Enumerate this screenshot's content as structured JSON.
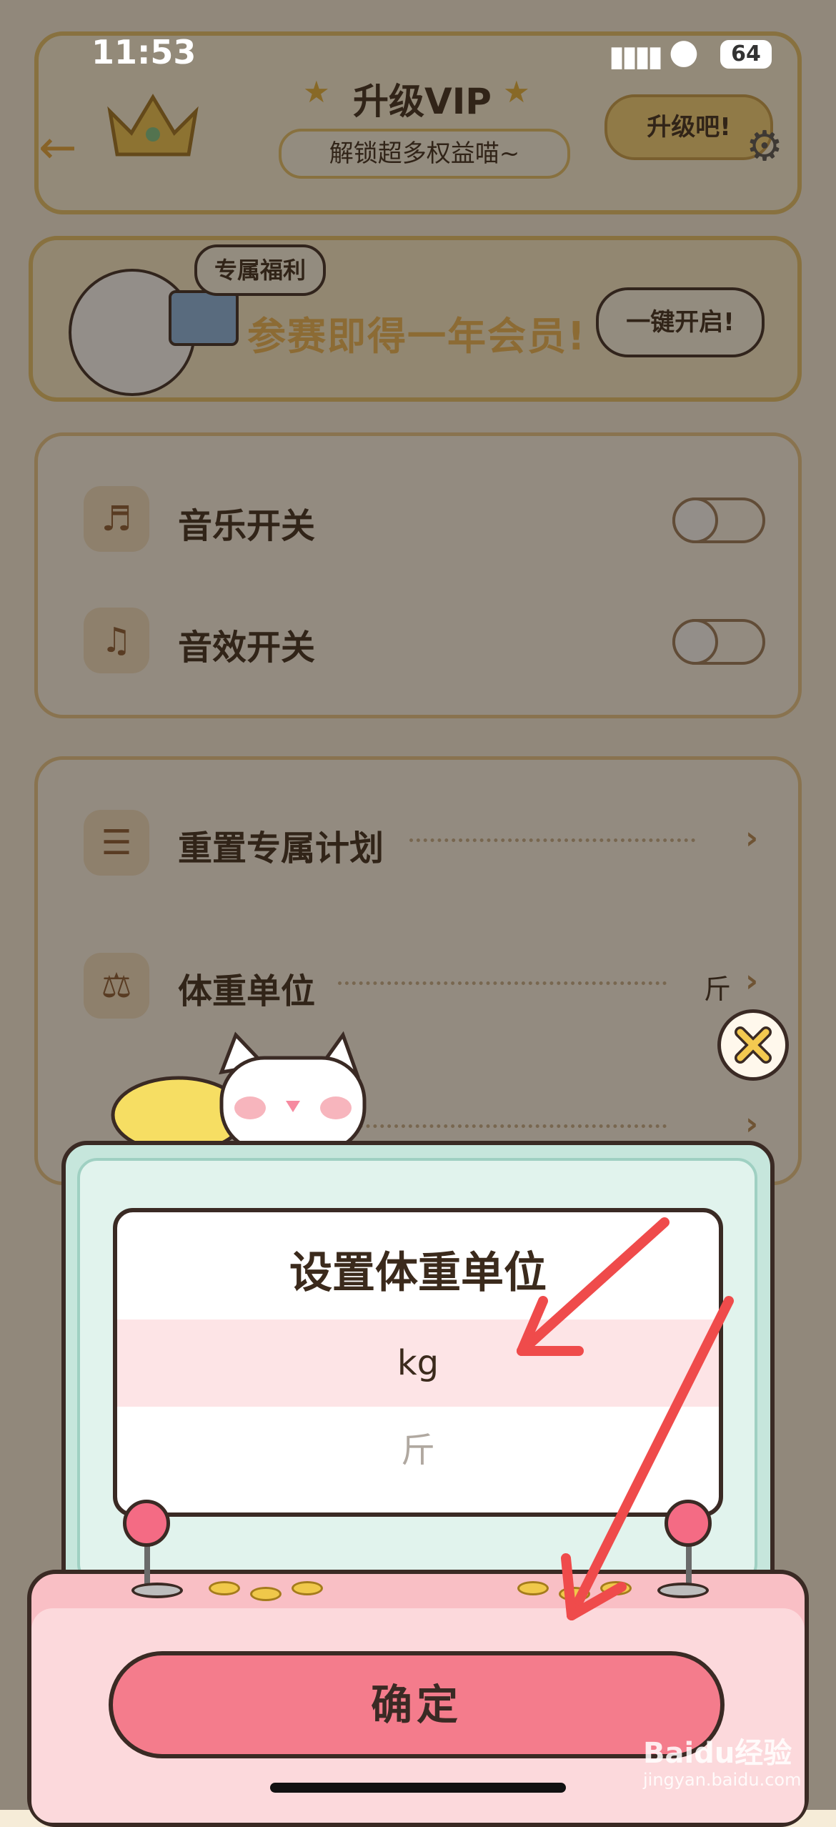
{
  "status_bar": {
    "time": "11:53",
    "battery": "64"
  },
  "vip_banner": {
    "title": "升级VIP",
    "subtitle": "解锁超多权益喵~",
    "button": "升级吧!"
  },
  "promo_banner": {
    "tag": "专属福利",
    "text": "参赛即得一年会员!",
    "button": "一键开启!"
  },
  "settings_toggles": [
    {
      "label": "音乐开关",
      "icon": "gramophone-icon",
      "on": false
    },
    {
      "label": "音效开关",
      "icon": "music-note-icon",
      "on": false
    }
  ],
  "settings_items": [
    {
      "label": "重置专属计划",
      "value": ""
    },
    {
      "label": "体重单位",
      "value": "斤"
    }
  ],
  "modal": {
    "title": "设置体重单位",
    "options": [
      {
        "label": "kg",
        "selected": true
      },
      {
        "label": "斤",
        "selected": false
      }
    ],
    "confirm": "确定"
  },
  "watermark": {
    "brand": "Baidu经验",
    "url": "jingyan.baidu.com"
  },
  "colors": {
    "accent": "#f47c8c",
    "selected_row": "#fde4e6",
    "panel": "#c6e6dc",
    "annotation_arrow": "#ef4b4b"
  }
}
